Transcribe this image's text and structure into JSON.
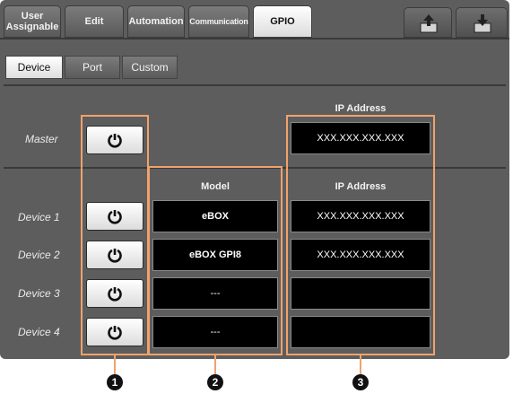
{
  "tabs": [
    {
      "label": "User\nAssignable",
      "active": false
    },
    {
      "label": "Edit",
      "active": false
    },
    {
      "label": "Automation",
      "active": false
    },
    {
      "label": "Communication",
      "active": false
    },
    {
      "label": "GPIO",
      "active": true
    }
  ],
  "toolbar_icons": [
    "export-icon",
    "import-icon"
  ],
  "sub_tabs": [
    {
      "label": "Device",
      "active": true
    },
    {
      "label": "Port",
      "active": false
    },
    {
      "label": "Custom",
      "active": false
    }
  ],
  "master": {
    "label": "Master",
    "ip_header": "IP  Address",
    "ip": "XXX.XXX.XXX.XXX"
  },
  "devices_header": {
    "model": "Model",
    "ip": "IP  Address"
  },
  "devices": [
    {
      "label": "Device 1",
      "model": "eBOX",
      "ip": "XXX.XXX.XXX.XXX"
    },
    {
      "label": "Device 2",
      "model": "eBOX GPI8",
      "ip": "XXX.XXX.XXX.XXX"
    },
    {
      "label": "Device 3",
      "model": "---",
      "ip": ""
    },
    {
      "label": "Device 4",
      "model": "---",
      "ip": ""
    }
  ],
  "callouts": [
    "1",
    "2",
    "3"
  ],
  "colors": {
    "highlight": "#f0a36c",
    "panel": "#5d5d5d",
    "field": "#000000"
  }
}
